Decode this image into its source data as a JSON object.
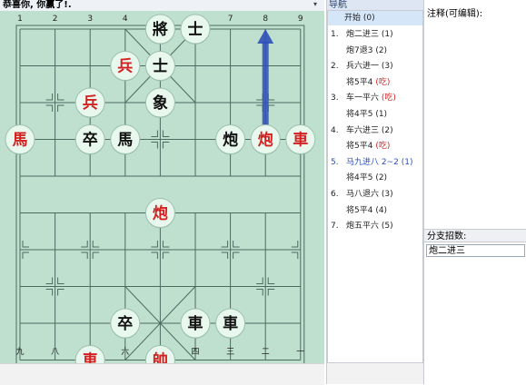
{
  "title": "恭喜你, 你赢了!.",
  "colors": {
    "board": "#bfe0cf",
    "red_piece": "#d42020",
    "black_piece": "#111111",
    "arrow": "#2f4fb8"
  },
  "board": {
    "top_numbers": [
      "1",
      "2",
      "3",
      "4",
      "5",
      "6",
      "7",
      "8",
      "9"
    ],
    "bottom_numbers": [
      "九",
      "八",
      "七",
      "六",
      "五",
      "四",
      "三",
      "二",
      "一"
    ],
    "pieces": [
      {
        "label": "將",
        "color": "black",
        "col": 4,
        "row": 0
      },
      {
        "label": "士",
        "color": "black",
        "col": 5,
        "row": 0
      },
      {
        "label": "兵",
        "color": "red",
        "col": 3,
        "row": 1
      },
      {
        "label": "士",
        "color": "black",
        "col": 4,
        "row": 1
      },
      {
        "label": "兵",
        "color": "red",
        "col": 2,
        "row": 2
      },
      {
        "label": "象",
        "color": "black",
        "col": 4,
        "row": 2
      },
      {
        "label": "馬",
        "color": "red",
        "col": 0,
        "row": 3
      },
      {
        "label": "卒",
        "color": "black",
        "col": 2,
        "row": 3
      },
      {
        "label": "馬",
        "color": "black",
        "col": 3,
        "row": 3
      },
      {
        "label": "炮",
        "color": "black",
        "col": 6,
        "row": 3
      },
      {
        "label": "炮",
        "color": "red",
        "col": 7,
        "row": 3
      },
      {
        "label": "車",
        "color": "red",
        "col": 8,
        "row": 3
      },
      {
        "label": "炮",
        "color": "red",
        "col": 4,
        "row": 5
      },
      {
        "label": "卒",
        "color": "black",
        "col": 3,
        "row": 8
      },
      {
        "label": "車",
        "color": "black",
        "col": 5,
        "row": 8
      },
      {
        "label": "車",
        "color": "black",
        "col": 6,
        "row": 8
      },
      {
        "label": "車",
        "color": "red",
        "col": 2,
        "row": 9
      },
      {
        "label": "帥",
        "color": "red",
        "col": 4,
        "row": 9
      }
    ],
    "last_move": {
      "from": {
        "col": 7,
        "row": 3
      },
      "to": {
        "col": 7,
        "row": 0
      }
    }
  },
  "nav": {
    "header": "导航",
    "start": "开始 (0)",
    "moves": [
      {
        "num": "1.",
        "text": "炮二进三 (1)",
        "style": "normal"
      },
      {
        "num": "",
        "text": "炮7退3 (2)",
        "style": "normal"
      },
      {
        "num": "2.",
        "text": "兵六进一 (3)",
        "style": "normal"
      },
      {
        "num": "",
        "text": "将5平4",
        "tag": "(吃)",
        "style": "normal"
      },
      {
        "num": "3.",
        "text": "车一平六",
        "tag": "(吃)",
        "style": "normal"
      },
      {
        "num": "",
        "text": "将4平5 (1)",
        "style": "normal"
      },
      {
        "num": "4.",
        "text": "车六进三 (2)",
        "style": "normal"
      },
      {
        "num": "",
        "text": "将5平4",
        "tag": "(吃)",
        "style": "normal"
      },
      {
        "num": "5.",
        "text": "马九进八 2~2 (1)",
        "style": "blue"
      },
      {
        "num": "",
        "text": "将4平5 (2)",
        "style": "normal"
      },
      {
        "num": "6.",
        "text": "马八退六 (3)",
        "style": "normal"
      },
      {
        "num": "",
        "text": "将5平4 (4)",
        "style": "normal"
      },
      {
        "num": "7.",
        "text": "炮五平六 (5)",
        "style": "normal"
      }
    ]
  },
  "comment": {
    "label": "注释(可编辑):"
  },
  "branch": {
    "header": "分支招数:",
    "items": [
      "炮二进三"
    ]
  }
}
